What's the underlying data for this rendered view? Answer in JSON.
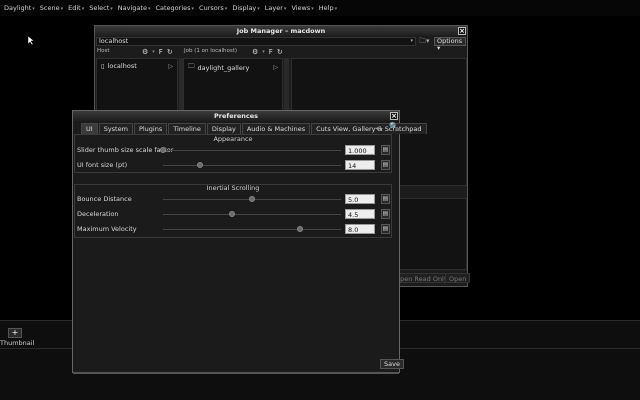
{
  "menubar": {
    "items": [
      {
        "label": "Daylight"
      },
      {
        "label": "Scene"
      },
      {
        "label": "Edit"
      },
      {
        "label": "Select"
      },
      {
        "label": "Navigate"
      },
      {
        "label": "Categories"
      },
      {
        "label": "Cursors"
      },
      {
        "label": "Display"
      },
      {
        "label": "Layer"
      },
      {
        "label": "Views"
      },
      {
        "label": "Help"
      }
    ]
  },
  "job_manager": {
    "title": "Job Manager  –  macdown",
    "address": "localhost",
    "options_label": "Options",
    "host_header": "Host",
    "job_header": "Job (1 on localhost)",
    "host_item": "localhost",
    "job_item": "daylight_gallery",
    "open_read_only_label": "Open Read Only",
    "open_label": "Open"
  },
  "bottom": {
    "thumbnail_label": "Thumbnail"
  },
  "preferences": {
    "title": "Preferences",
    "tabs": [
      {
        "label": "UI",
        "active": true
      },
      {
        "label": "System"
      },
      {
        "label": "Plugins"
      },
      {
        "label": "Timeline"
      },
      {
        "label": "Display"
      },
      {
        "label": "Audio & Machines"
      },
      {
        "label": "Cuts View, Gallery & Scratchpad"
      }
    ],
    "appearance": {
      "title": "Appearance",
      "rows": [
        {
          "label": "Slider thumb size scale factor",
          "value": "1.000",
          "level": 0.0
        },
        {
          "label": "UI font size (pt)",
          "value": "14",
          "level": 0.21
        }
      ]
    },
    "inertial": {
      "title": "Inertial Scrolling",
      "rows": [
        {
          "label": "Bounce Distance",
          "value": "5.0",
          "level": 0.5
        },
        {
          "label": "Deceleration",
          "value": "4.5",
          "level": 0.39
        },
        {
          "label": "Maximum Velocity",
          "value": "8.0",
          "level": 0.77
        }
      ]
    },
    "save_label": "Save"
  }
}
